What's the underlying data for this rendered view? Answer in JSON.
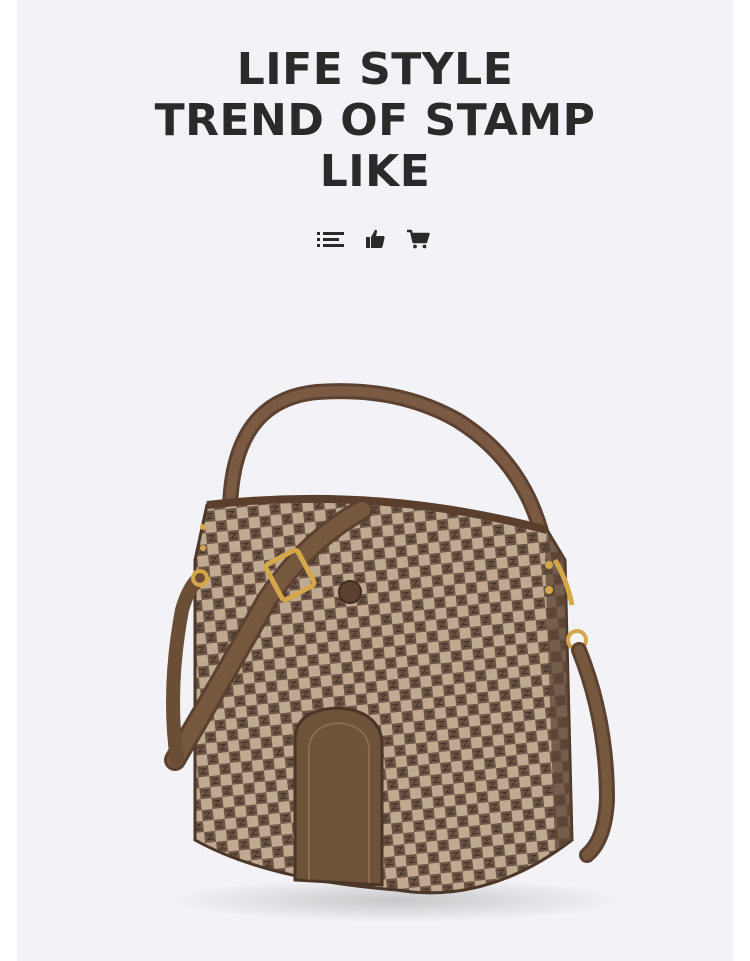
{
  "heading": {
    "line1": "LIFE STYLE",
    "line2": "TREND OF STAMP",
    "line3": "LIKE"
  },
  "icons": [
    "list-icon",
    "thumbs-up-icon",
    "cart-icon"
  ],
  "colors": {
    "background": "#f3f3f7",
    "text": "#2a2a2a",
    "leather": "#6b4e36",
    "canvas_light": "#b9a38c",
    "canvas_dark": "#6d5646",
    "hardware": "#d4a74a"
  }
}
